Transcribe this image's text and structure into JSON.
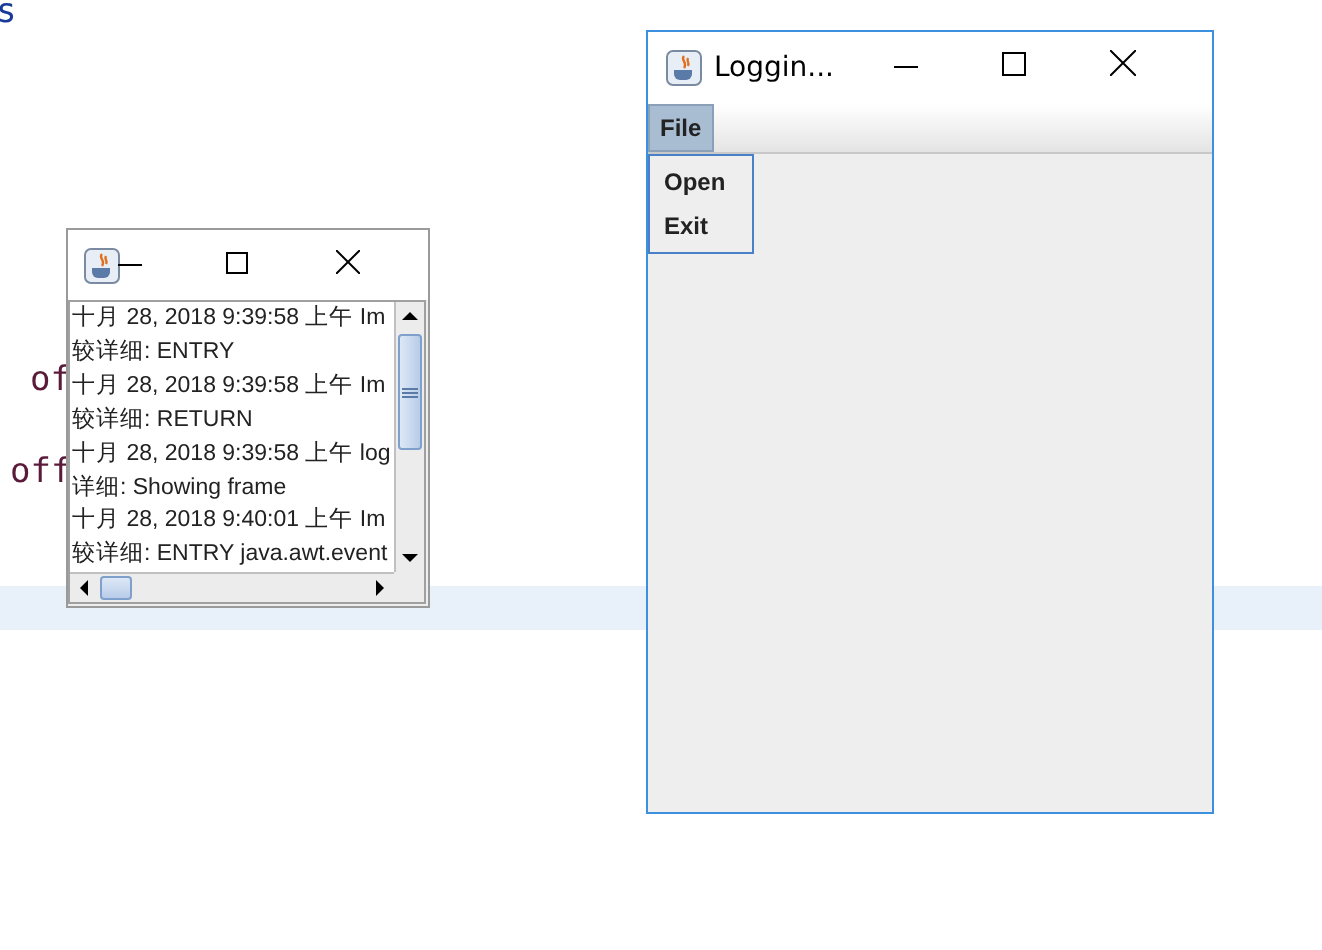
{
  "background_editor": {
    "code_lines": [
      {
        "text": "s",
        "kind": "keyword"
      },
      {
        "text": "of",
        "kind": "plain"
      },
      {
        "text": "off",
        "kind": "plain"
      }
    ],
    "highlighted_line": true
  },
  "log_window": {
    "log_lines": [
      "十月 28, 2018 9:39:58 上午 Im",
      "较详细: ENTRY",
      "十月 28, 2018 9:39:58 上午 Im",
      "较详细: RETURN",
      "十月 28, 2018 9:39:58 上午 log",
      "详细: Showing frame",
      "十月 28, 2018 9:40:01 上午 Im",
      "较详细: ENTRY java.awt.event"
    ]
  },
  "main_window": {
    "title": "Loggin...",
    "menu": [
      {
        "label": "File",
        "selected": true
      }
    ],
    "menu_popup": {
      "items": [
        {
          "label": "Open"
        },
        {
          "label": "Exit"
        }
      ]
    }
  }
}
